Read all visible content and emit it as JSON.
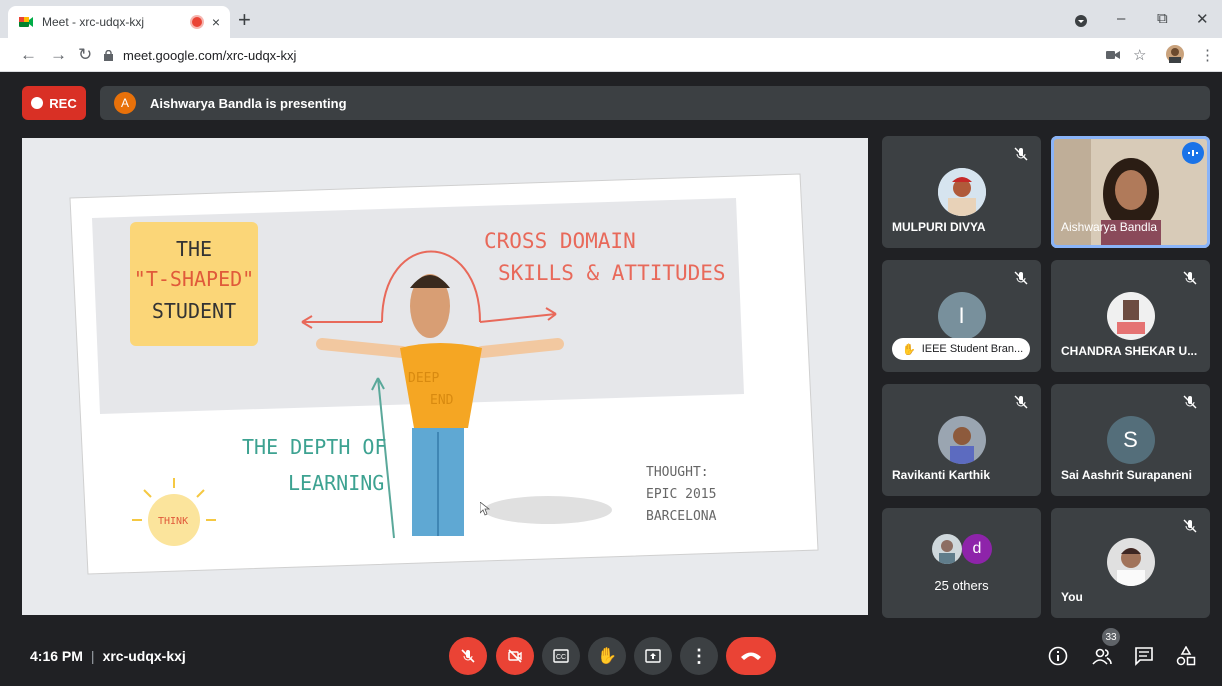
{
  "browser": {
    "tab_title": "Meet - xrc-udqx-kxj",
    "tab_close": "×",
    "new_tab": "+",
    "url": "meet.google.com/xrc-udqx-kxj",
    "win_min": "–",
    "win_max": "⧉",
    "win_close": "✕"
  },
  "meet": {
    "rec_label": "REC",
    "presenter_initial": "A",
    "presenting_text": "Aishwarya Bandla is presenting",
    "time": "4:16 PM",
    "meeting_code": "xrc-udqx-kxj",
    "participants_count": "33"
  },
  "slide": {
    "title_line1": "THE",
    "title_line2": "\"T-SHAPED\"",
    "title_line3": "STUDENT",
    "cross_line1": "CROSS DOMAIN",
    "cross_line2": "SKILLS & ATTITUDES",
    "depth_line1": "THE DEPTH OF",
    "depth_line2": "LEARNING",
    "shirt_line1": "DEEP",
    "shirt_line2": "END",
    "credit_line1": "THOUGHT:",
    "credit_line2": "EPIC 2015",
    "credit_line3": "BARCELONA",
    "bulb_text": "THINK"
  },
  "participants": [
    {
      "name": "MULPURI DIVYA"
    },
    {
      "name": "Aishwarya Bandla"
    },
    {
      "initial": "I",
      "name": "IEEE Student Bran..."
    },
    {
      "name": "CHANDRA SHEKAR U..."
    },
    {
      "name": "Ravikanti Karthik"
    },
    {
      "initial": "S",
      "name": "Sai Aashrit Surapaneni"
    },
    {
      "initial": "d",
      "name": "25 others"
    },
    {
      "name": "You"
    }
  ],
  "colors": {
    "accent_red": "#ea4335",
    "meet_bg": "#202124",
    "tile_bg": "#3c4043",
    "active_blue": "#8ab4f8"
  }
}
